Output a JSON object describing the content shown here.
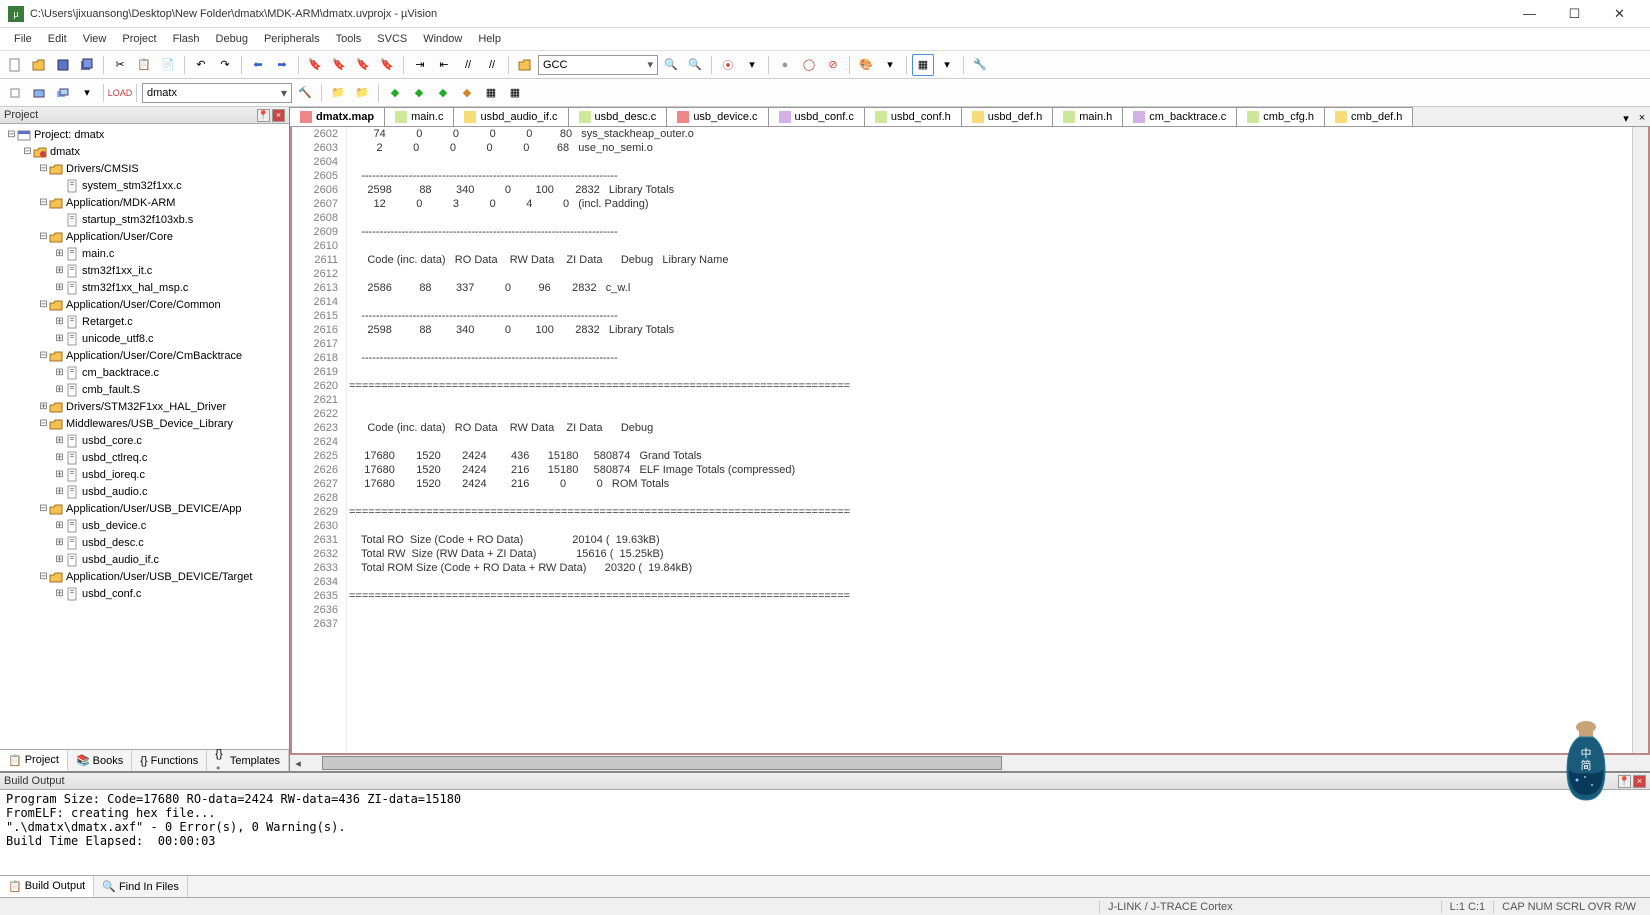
{
  "title": "C:\\Users\\jixuansong\\Desktop\\New Folder\\dmatx\\MDK-ARM\\dmatx.uvprojx - µVision",
  "menu": [
    "File",
    "Edit",
    "View",
    "Project",
    "Flash",
    "Debug",
    "Peripherals",
    "Tools",
    "SVCS",
    "Window",
    "Help"
  ],
  "target": "GCC",
  "tb2_sel": "dmatx",
  "proj_panel_title": "Project",
  "tree": [
    {
      "d": 0,
      "exp": "-",
      "icon": "proj",
      "label": "Project: dmatx"
    },
    {
      "d": 1,
      "exp": "-",
      "icon": "target",
      "label": "dmatx"
    },
    {
      "d": 2,
      "exp": "-",
      "icon": "folder",
      "label": "Drivers/CMSIS"
    },
    {
      "d": 3,
      "exp": "",
      "icon": "file",
      "label": "system_stm32f1xx.c"
    },
    {
      "d": 2,
      "exp": "-",
      "icon": "folder",
      "label": "Application/MDK-ARM"
    },
    {
      "d": 3,
      "exp": "",
      "icon": "file",
      "label": "startup_stm32f103xb.s"
    },
    {
      "d": 2,
      "exp": "-",
      "icon": "folder",
      "label": "Application/User/Core"
    },
    {
      "d": 3,
      "exp": "+",
      "icon": "file",
      "label": "main.c"
    },
    {
      "d": 3,
      "exp": "+",
      "icon": "file",
      "label": "stm32f1xx_it.c"
    },
    {
      "d": 3,
      "exp": "+",
      "icon": "file",
      "label": "stm32f1xx_hal_msp.c"
    },
    {
      "d": 2,
      "exp": "-",
      "icon": "folder",
      "label": "Application/User/Core/Common"
    },
    {
      "d": 3,
      "exp": "+",
      "icon": "file",
      "label": "Retarget.c"
    },
    {
      "d": 3,
      "exp": "+",
      "icon": "file",
      "label": "unicode_utf8.c"
    },
    {
      "d": 2,
      "exp": "-",
      "icon": "folder",
      "label": "Application/User/Core/CmBacktrace"
    },
    {
      "d": 3,
      "exp": "+",
      "icon": "file",
      "label": "cm_backtrace.c"
    },
    {
      "d": 3,
      "exp": "+",
      "icon": "file",
      "label": "cmb_fault.S"
    },
    {
      "d": 2,
      "exp": "+",
      "icon": "folder",
      "label": "Drivers/STM32F1xx_HAL_Driver"
    },
    {
      "d": 2,
      "exp": "-",
      "icon": "folder",
      "label": "Middlewares/USB_Device_Library"
    },
    {
      "d": 3,
      "exp": "+",
      "icon": "file",
      "label": "usbd_core.c"
    },
    {
      "d": 3,
      "exp": "+",
      "icon": "file",
      "label": "usbd_ctlreq.c"
    },
    {
      "d": 3,
      "exp": "+",
      "icon": "file",
      "label": "usbd_ioreq.c"
    },
    {
      "d": 3,
      "exp": "+",
      "icon": "file",
      "label": "usbd_audio.c"
    },
    {
      "d": 2,
      "exp": "-",
      "icon": "folder",
      "label": "Application/User/USB_DEVICE/App"
    },
    {
      "d": 3,
      "exp": "+",
      "icon": "file",
      "label": "usb_device.c"
    },
    {
      "d": 3,
      "exp": "+",
      "icon": "file",
      "label": "usbd_desc.c"
    },
    {
      "d": 3,
      "exp": "+",
      "icon": "file",
      "label": "usbd_audio_if.c"
    },
    {
      "d": 2,
      "exp": "-",
      "icon": "folder",
      "label": "Application/User/USB_DEVICE/Target"
    },
    {
      "d": 3,
      "exp": "+",
      "icon": "file",
      "label": "usbd_conf.c"
    }
  ],
  "proj_tabs": [
    {
      "label": "Project",
      "icon": "proj",
      "active": true
    },
    {
      "label": "Books",
      "icon": "books",
      "active": false
    },
    {
      "label": "Functions",
      "icon": "func",
      "active": false
    },
    {
      "label": "Templates",
      "icon": "tmpl",
      "active": false
    }
  ],
  "file_tabs": [
    {
      "label": "dmatx.map",
      "cls": "ft-map",
      "active": true
    },
    {
      "label": "main.c",
      "cls": "ft-c"
    },
    {
      "label": "usbd_audio_if.c",
      "cls": "ft-if"
    },
    {
      "label": "usbd_desc.c",
      "cls": "ft-c"
    },
    {
      "label": "usb_device.c",
      "cls": "ft-map"
    },
    {
      "label": "usbd_conf.c",
      "cls": "ft-h"
    },
    {
      "label": "usbd_conf.h",
      "cls": "ft-c"
    },
    {
      "label": "usbd_def.h",
      "cls": "ft-if"
    },
    {
      "label": "main.h",
      "cls": "ft-c"
    },
    {
      "label": "cm_backtrace.c",
      "cls": "ft-h"
    },
    {
      "label": "cmb_cfg.h",
      "cls": "ft-c"
    },
    {
      "label": "cmb_def.h",
      "cls": "ft-if"
    }
  ],
  "gutter_start": 2602,
  "gutter_end": 2637,
  "code_lines": [
    "        74          0          0          0          0         80   sys_stackheap_outer.o",
    "         2          0          0          0          0         68   use_no_semi.o",
    "",
    "    ----------------------------------------------------------------------",
    "      2598         88        340          0        100       2832   Library Totals",
    "        12          0          3          0          4          0   (incl. Padding)",
    "",
    "    ----------------------------------------------------------------------",
    "",
    "      Code (inc. data)   RO Data    RW Data    ZI Data      Debug   Library Name",
    "",
    "      2586         88        337          0         96       2832   c_w.l",
    "",
    "    ----------------------------------------------------------------------",
    "      2598         88        340          0        100       2832   Library Totals",
    "",
    "    ----------------------------------------------------------------------",
    "",
    "==============================================================================",
    "",
    "",
    "      Code (inc. data)   RO Data    RW Data    ZI Data      Debug   ",
    "",
    "     17680       1520       2424        436      15180     580874   Grand Totals",
    "     17680       1520       2424        216      15180     580874   ELF Image Totals (compressed)",
    "     17680       1520       2424        216          0          0   ROM Totals",
    "",
    "==============================================================================",
    "",
    "    Total RO  Size (Code + RO Data)                20104 (  19.63kB)",
    "    Total RW  Size (RW Data + ZI Data)             15616 (  15.25kB)",
    "    Total ROM Size (Code + RO Data + RW Data)      20320 (  19.84kB)",
    "",
    "==============================================================================",
    "",
    ""
  ],
  "build_title": "Build Output",
  "build_lines": [
    "Program Size: Code=17680 RO-data=2424 RW-data=436 ZI-data=15180",
    "FromELF: creating hex file...",
    "\".\\dmatx\\dmatx.axf\" - 0 Error(s), 0 Warning(s).",
    "Build Time Elapsed:  00:00:03"
  ],
  "build_tabs": [
    {
      "label": "Build Output",
      "active": true
    },
    {
      "label": "Find In Files",
      "active": false
    }
  ],
  "status": {
    "debug": "J-LINK / J-TRACE Cortex",
    "pos": "L:1 C:1",
    "flags": "CAP NUM SCRL OVR R/W"
  }
}
